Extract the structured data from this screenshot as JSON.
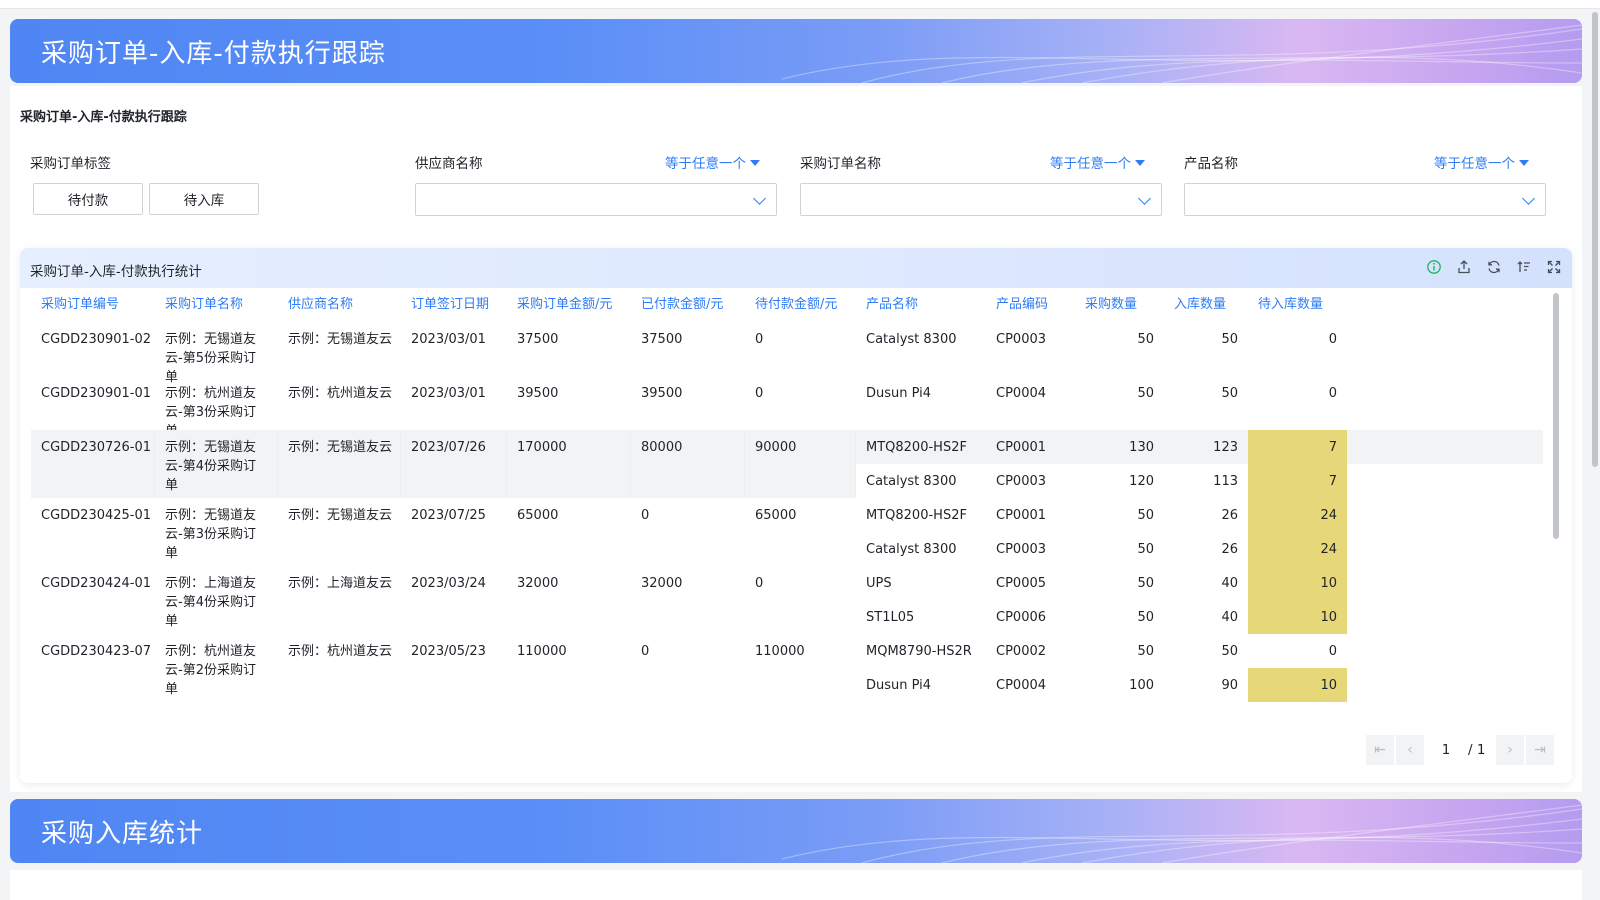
{
  "banner1": {
    "title": "采购订单-入库-付款执行跟踪"
  },
  "section1": {
    "title": "采购订单-入库-付款执行跟踪",
    "filters": {
      "tag": {
        "label": "采购订单标签",
        "options": [
          "待付款",
          "待入库"
        ]
      },
      "supplier": {
        "label": "供应商名称",
        "op": "等于任意一个",
        "value": ""
      },
      "order_name": {
        "label": "采购订单名称",
        "op": "等于任意一个",
        "value": ""
      },
      "product": {
        "label": "产品名称",
        "op": "等于任意一个",
        "value": ""
      }
    }
  },
  "card": {
    "title": "采购订单-入库-付款执行统计",
    "tools": [
      "info-icon",
      "export-icon",
      "refresh-icon",
      "sort-icon",
      "fullscreen-icon"
    ],
    "columns": [
      "采购订单编号",
      "采购订单名称",
      "供应商名称",
      "订单签订日期",
      "采购订单金额/元",
      "已付款金额/元",
      "待付款金额/元",
      "产品名称",
      "产品编码",
      "采购数量",
      "入库数量",
      "待入库数量"
    ],
    "orders": [
      {
        "no": "CGDD230901-02",
        "name": "示例：无锡道友云-第5份采购订单",
        "supplier": "示例：无锡道友云",
        "date": "2023/03/01",
        "amount": "37500",
        "paid": "37500",
        "unpaid": "0",
        "products": [
          {
            "name": "Catalyst 8300",
            "code": "CP0003",
            "qty": "50",
            "in": "50",
            "pending": "0"
          }
        ]
      },
      {
        "no": "CGDD230901-01",
        "name": "示例：杭州道友云-第3份采购订单",
        "supplier": "示例：杭州道友云",
        "date": "2023/03/01",
        "amount": "39500",
        "paid": "39500",
        "unpaid": "0",
        "products": [
          {
            "name": "Dusun Pi4",
            "code": "CP0004",
            "qty": "50",
            "in": "50",
            "pending": "0"
          }
        ]
      },
      {
        "no": "CGDD230726-01",
        "name": "示例：无锡道友云-第4份采购订单",
        "supplier": "示例：无锡道友云",
        "date": "2023/07/26",
        "amount": "170000",
        "paid": "80000",
        "unpaid": "90000",
        "products": [
          {
            "name": "MTQ8200-HS2F",
            "code": "CP0001",
            "qty": "130",
            "in": "123",
            "pending": "7"
          },
          {
            "name": "Catalyst 8300",
            "code": "CP0003",
            "qty": "120",
            "in": "113",
            "pending": "7"
          }
        ]
      },
      {
        "no": "CGDD230425-01",
        "name": "示例：无锡道友云-第3份采购订单",
        "supplier": "示例：无锡道友云",
        "date": "2023/07/25",
        "amount": "65000",
        "paid": "0",
        "unpaid": "65000",
        "products": [
          {
            "name": "MTQ8200-HS2F",
            "code": "CP0001",
            "qty": "50",
            "in": "26",
            "pending": "24"
          },
          {
            "name": "Catalyst 8300",
            "code": "CP0003",
            "qty": "50",
            "in": "26",
            "pending": "24"
          }
        ]
      },
      {
        "no": "CGDD230424-01",
        "name": "示例：上海道友云-第4份采购订单",
        "supplier": "示例：上海道友云",
        "date": "2023/03/24",
        "amount": "32000",
        "paid": "32000",
        "unpaid": "0",
        "products": [
          {
            "name": "UPS",
            "code": "CP0005",
            "qty": "50",
            "in": "40",
            "pending": "10"
          },
          {
            "name": "ST1L05",
            "code": "CP0006",
            "qty": "50",
            "in": "40",
            "pending": "10"
          }
        ]
      },
      {
        "no": "CGDD230423-07",
        "name": "示例：杭州道友云-第2份采购订单",
        "supplier": "示例：杭州道友云",
        "date": "2023/05/23",
        "amount": "110000",
        "paid": "0",
        "unpaid": "110000",
        "products": [
          {
            "name": "MQM8790-HS2R",
            "code": "CP0002",
            "qty": "50",
            "in": "50",
            "pending": "0"
          },
          {
            "name": "Dusun Pi4",
            "code": "CP0004",
            "qty": "100",
            "in": "90",
            "pending": "10"
          }
        ]
      }
    ],
    "pagination": {
      "current": "1",
      "total": "/ 1"
    }
  },
  "banner2": {
    "title": "采购入库统计"
  },
  "colors": {
    "accent": "#2f7cf5",
    "highlight": "#e6d778"
  }
}
